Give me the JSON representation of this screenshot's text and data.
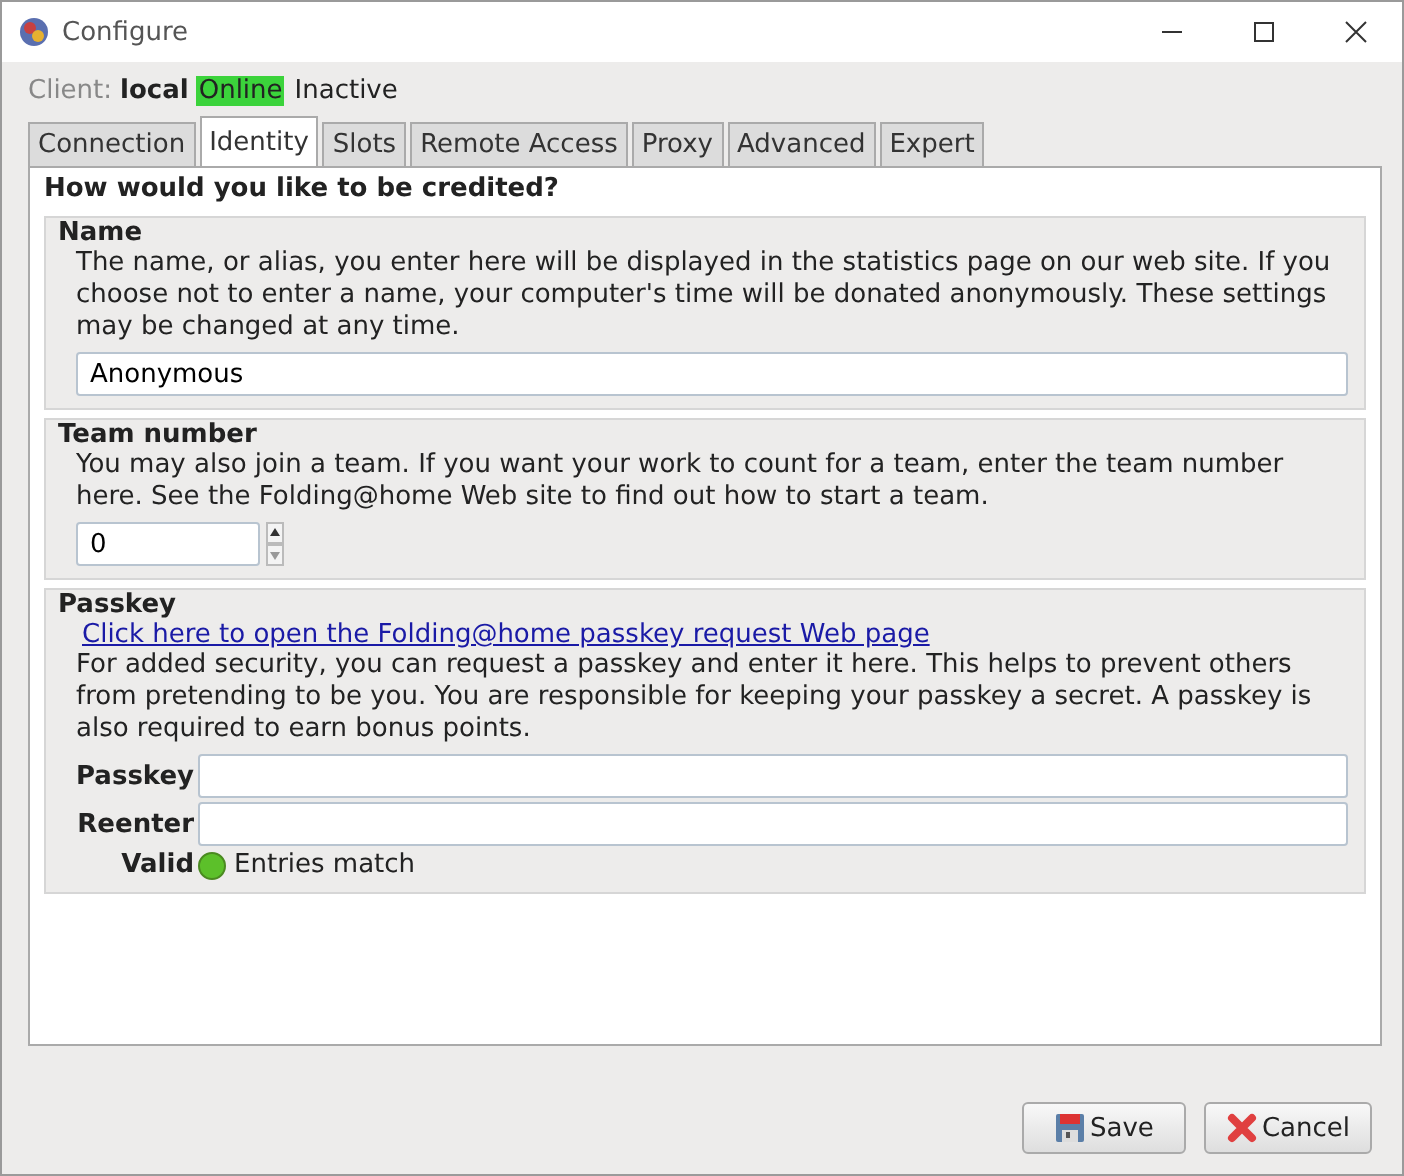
{
  "window": {
    "title": "Configure"
  },
  "client": {
    "label": "Client:",
    "name": "local",
    "states": [
      {
        "label": "Online",
        "active": true
      },
      {
        "label": "Inactive",
        "active": false
      }
    ]
  },
  "tabs": [
    {
      "label": "Connection",
      "selected": false
    },
    {
      "label": "Identity",
      "selected": true
    },
    {
      "label": "Slots",
      "selected": false
    },
    {
      "label": "Remote Access",
      "selected": false
    },
    {
      "label": "Proxy",
      "selected": false
    },
    {
      "label": "Advanced",
      "selected": false
    },
    {
      "label": "Expert",
      "selected": false
    }
  ],
  "heading": "How would you like to be credited?",
  "name_group": {
    "title": "Name",
    "description": "The name, or alias, you enter here will be displayed in the statistics page on our web site.  If you choose not to enter a name, your computer's time will be donated anonymously.  These settings may be changed at any time.",
    "value": "Anonymous"
  },
  "team_group": {
    "title": "Team number",
    "description": "You may also join a team.  If you want your work to count for a team, enter the team number here.  See the Folding@home Web site to find out how to start a team.",
    "value": "0"
  },
  "passkey_group": {
    "title": "Passkey",
    "link": "Click here to open the Folding@home passkey request Web page",
    "description": "For added security, you can request a passkey and enter it here.  This helps to prevent others from pretending to be you.  You are responsible for keeping your passkey a secret.  A passkey is also required to earn bonus points.",
    "fields": [
      {
        "label": "Passkey"
      },
      {
        "label": "Reenter"
      }
    ],
    "valid": {
      "label": "Valid",
      "ok": true,
      "message": "Entries match"
    }
  },
  "buttons": [
    {
      "kind": "save",
      "label": "Save"
    },
    {
      "kind": "cancel",
      "label": "Cancel"
    }
  ]
}
